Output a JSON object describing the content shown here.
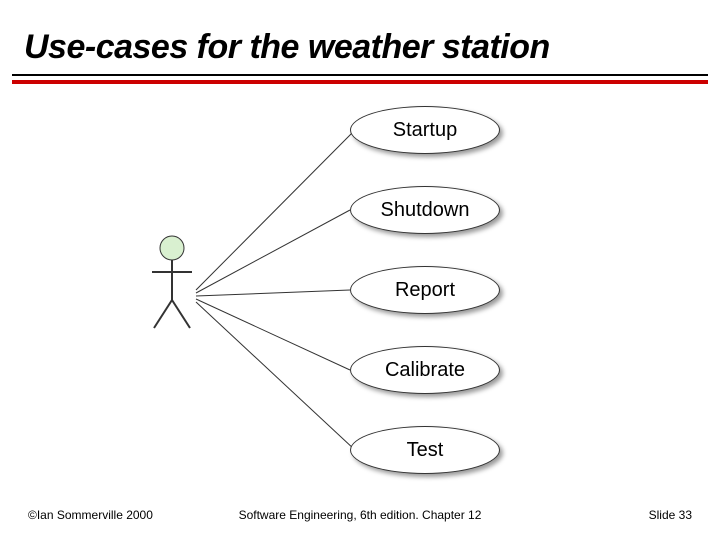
{
  "title": "Use-cases for the weather station",
  "usecases": {
    "u0": "Startup",
    "u1": "Shutdown",
    "u2": "Report",
    "u3": "Calibrate",
    "u4": "Test"
  },
  "footer": {
    "left": "©Ian Sommerville 2000",
    "center": "Software Engineering, 6th edition. Chapter 12",
    "right": "Slide 33"
  }
}
